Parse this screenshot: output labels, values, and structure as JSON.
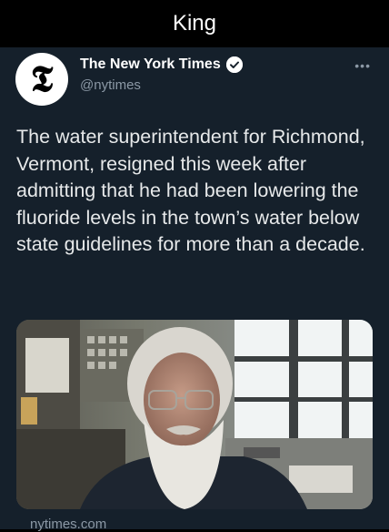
{
  "caption": "King",
  "tweet": {
    "author_name": "The New York Times",
    "author_handle": "@nytimes",
    "avatar_letter": "𝕿",
    "verified_icon": "verified-badge-icon",
    "more_icon": "more-options-icon",
    "text": "The water superintendent for Richmond, Vermont, resigned this week after admitting that he had been lowering the fluoride levels in the town’s water below state guidelines for more than a decade.",
    "media_image": "photo of a man with white hair and long white beard in glasses",
    "link_domain": "nytimes.com"
  }
}
